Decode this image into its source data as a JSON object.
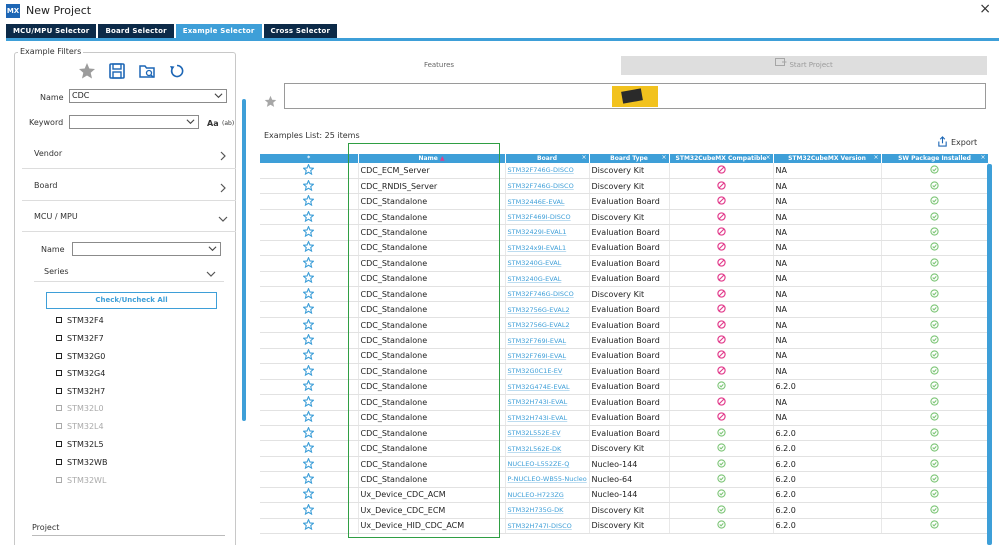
{
  "window": {
    "title": "New Project",
    "app_icon": "MX",
    "close_label": "×"
  },
  "tabs": [
    {
      "label": "MCU/MPU Selector",
      "active": false
    },
    {
      "label": "Board Selector",
      "active": false
    },
    {
      "label": "Example Selector",
      "active": true
    },
    {
      "label": "Cross Selector",
      "active": false
    }
  ],
  "filters": {
    "title": "Example Filters",
    "name_label": "Name",
    "name_value": "CDC",
    "keyword_label": "Keyword",
    "keyword_value": "",
    "case_label": "Aa",
    "regex_label": "(ab)",
    "vendor_label": "Vendor",
    "board_label": "Board",
    "mcu_label": "MCU / MPU",
    "mcu_name_label": "Name",
    "mcu_name_value": "",
    "series_label": "Series",
    "check_all_label": "Check/Uncheck All",
    "series": [
      {
        "label": "STM32F4",
        "enabled": true
      },
      {
        "label": "STM32F7",
        "enabled": true
      },
      {
        "label": "STM32G0",
        "enabled": true
      },
      {
        "label": "STM32G4",
        "enabled": true
      },
      {
        "label": "STM32H7",
        "enabled": true
      },
      {
        "label": "STM32L0",
        "enabled": false
      },
      {
        "label": "STM32L4",
        "enabled": false
      },
      {
        "label": "STM32L5",
        "enabled": true
      },
      {
        "label": "STM32WB",
        "enabled": true
      },
      {
        "label": "STM32WL",
        "enabled": false
      }
    ],
    "project_label": "Project"
  },
  "right": {
    "features_label": "Features",
    "start_project_label": "Start Project",
    "list_count": "Examples List: 25 items",
    "export_label": "Export"
  },
  "table": {
    "headers": [
      "*",
      "Name",
      "Board",
      "Board Type",
      "STM32CubeMX Compatible",
      "STM32CubeMX Version",
      "SW Package Installed"
    ],
    "rows": [
      {
        "name": "CDC_ECM_Server",
        "board": "STM32F746G-DISCO",
        "type": "Discovery Kit",
        "compatible": false,
        "version": "NA"
      },
      {
        "name": "CDC_RNDIS_Server",
        "board": "STM32F746G-DISCO",
        "type": "Discovery Kit",
        "compatible": false,
        "version": "NA"
      },
      {
        "name": "CDC_Standalone",
        "board": "STM32446E-EVAL",
        "type": "Evaluation Board",
        "compatible": false,
        "version": "NA"
      },
      {
        "name": "CDC_Standalone",
        "board": "STM32F469I-DISCO",
        "type": "Discovery Kit",
        "compatible": false,
        "version": "NA"
      },
      {
        "name": "CDC_Standalone",
        "board": "STM32429I-EVAL1",
        "type": "Evaluation Board",
        "compatible": false,
        "version": "NA"
      },
      {
        "name": "CDC_Standalone",
        "board": "STM324x9I-EVAL1",
        "type": "Evaluation Board",
        "compatible": false,
        "version": "NA"
      },
      {
        "name": "CDC_Standalone",
        "board": "STM3240G-EVAL",
        "type": "Evaluation Board",
        "compatible": false,
        "version": "NA"
      },
      {
        "name": "CDC_Standalone",
        "board": "STM3240G-EVAL",
        "type": "Evaluation Board",
        "compatible": false,
        "version": "NA"
      },
      {
        "name": "CDC_Standalone",
        "board": "STM32F746G-DISCO",
        "type": "Discovery Kit",
        "compatible": false,
        "version": "NA"
      },
      {
        "name": "CDC_Standalone",
        "board": "STM32756G-EVAL2",
        "type": "Evaluation Board",
        "compatible": false,
        "version": "NA"
      },
      {
        "name": "CDC_Standalone",
        "board": "STM32756G-EVAL2",
        "type": "Evaluation Board",
        "compatible": false,
        "version": "NA"
      },
      {
        "name": "CDC_Standalone",
        "board": "STM32F769I-EVAL",
        "type": "Evaluation Board",
        "compatible": false,
        "version": "NA"
      },
      {
        "name": "CDC_Standalone",
        "board": "STM32F769I-EVAL",
        "type": "Evaluation Board",
        "compatible": false,
        "version": "NA"
      },
      {
        "name": "CDC_Standalone",
        "board": "STM32G0C1E-EV",
        "type": "Evaluation Board",
        "compatible": false,
        "version": "NA"
      },
      {
        "name": "CDC_Standalone",
        "board": "STM32G474E-EVAL",
        "type": "Evaluation Board",
        "compatible": true,
        "version": "6.2.0"
      },
      {
        "name": "CDC_Standalone",
        "board": "STM32H743I-EVAL",
        "type": "Evaluation Board",
        "compatible": false,
        "version": "NA"
      },
      {
        "name": "CDC_Standalone",
        "board": "STM32H743I-EVAL",
        "type": "Evaluation Board",
        "compatible": false,
        "version": "NA"
      },
      {
        "name": "CDC_Standalone",
        "board": "STM32L552E-EV",
        "type": "Evaluation Board",
        "compatible": true,
        "version": "6.2.0"
      },
      {
        "name": "CDC_Standalone",
        "board": "STM32L562E-DK",
        "type": "Discovery Kit",
        "compatible": true,
        "version": "6.2.0"
      },
      {
        "name": "CDC_Standalone",
        "board": "NUCLEO-L552ZE-Q",
        "type": "Nucleo-144",
        "compatible": true,
        "version": "6.2.0"
      },
      {
        "name": "CDC_Standalone",
        "board": "P-NUCLEO-WB55-Nucleo",
        "type": "Nucleo-64",
        "compatible": true,
        "version": "6.2.0"
      },
      {
        "name": "Ux_Device_CDC_ACM",
        "board": "NUCLEO-H723ZG",
        "type": "Nucleo-144",
        "compatible": true,
        "version": "6.2.0"
      },
      {
        "name": "Ux_Device_CDC_ECM",
        "board": "STM32H735G-DK",
        "type": "Discovery Kit",
        "compatible": true,
        "version": "6.2.0"
      },
      {
        "name": "Ux_Device_HID_CDC_ACM",
        "board": "STM32H747I-DISCO",
        "type": "Discovery Kit",
        "compatible": true,
        "version": "6.2.0"
      }
    ]
  },
  "colors": {
    "accent": "#3e9fd8",
    "dark_tab": "#0c2a48",
    "incompatible": "#e23c8c",
    "compatible": "#7cc576",
    "highlight": "#2f9e43"
  }
}
